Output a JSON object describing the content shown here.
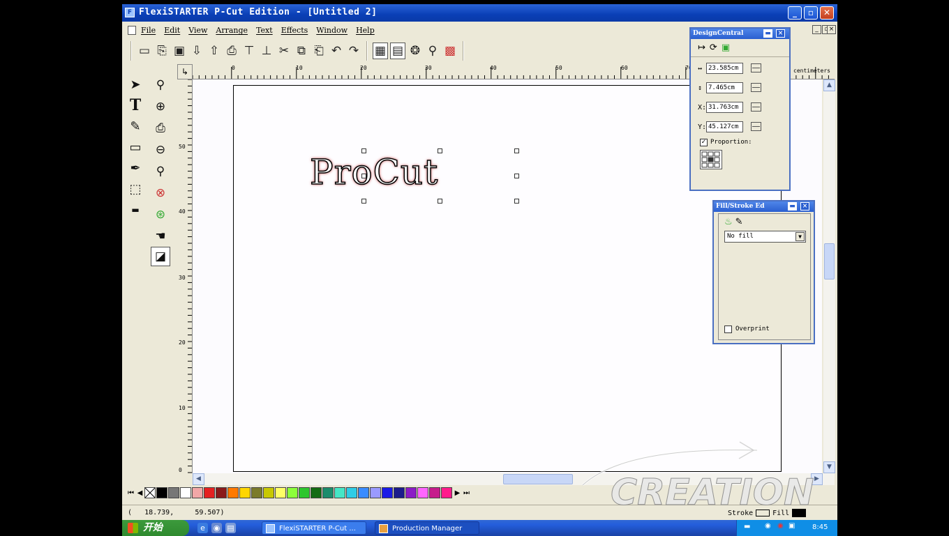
{
  "window": {
    "title": "FlexiSTARTER P-Cut Edition - [Untitled 2]",
    "min_glyph": "_",
    "max_glyph": "▫",
    "close_glyph": "✕"
  },
  "menu": {
    "items": [
      {
        "label": "File"
      },
      {
        "label": "Edit"
      },
      {
        "label": "View"
      },
      {
        "label": "Arrange"
      },
      {
        "label": "Text"
      },
      {
        "label": "Effects"
      },
      {
        "label": "Window"
      },
      {
        "label": "Help"
      }
    ]
  },
  "toolbar": {
    "buttons": [
      {
        "icon": "new-icon",
        "glyph": "▭"
      },
      {
        "icon": "open-icon",
        "glyph": "⎘"
      },
      {
        "icon": "save-icon",
        "glyph": "▣"
      },
      {
        "icon": "import-icon",
        "glyph": "⇩"
      },
      {
        "icon": "export-icon",
        "glyph": "⇧"
      },
      {
        "icon": "print-icon",
        "glyph": "⎙"
      },
      {
        "icon": "cut-to-plotter-icon",
        "glyph": "⊤"
      },
      {
        "icon": "production-icon",
        "glyph": "⊥"
      },
      {
        "icon": "scissors-icon",
        "glyph": "✂"
      },
      {
        "icon": "copy-icon",
        "glyph": "⧉"
      },
      {
        "icon": "paste-icon",
        "glyph": "⎗"
      },
      {
        "icon": "undo-icon",
        "glyph": "↶"
      },
      {
        "icon": "redo-icon",
        "glyph": "↷"
      },
      {
        "icon": "design-central-icon",
        "glyph": "▦"
      },
      {
        "icon": "fill-stroke-icon",
        "glyph": "▤"
      },
      {
        "icon": "color-icon",
        "glyph": "❂"
      },
      {
        "icon": "zoom-tool-icon",
        "glyph": "⚲"
      },
      {
        "icon": "swatch-icon",
        "glyph": "▩"
      }
    ]
  },
  "rulers": {
    "units": "centimeters",
    "h_labels": [
      "0",
      "10",
      "20",
      "30",
      "40",
      "50",
      "60",
      "70"
    ],
    "v_labels": [
      "50",
      "40",
      "30",
      "20",
      "10",
      "0"
    ]
  },
  "canvas": {
    "text": "ProCut"
  },
  "design_central": {
    "title": "DesignCentral",
    "width": "23.585cm",
    "height": "7.465cm",
    "x_label": "X:",
    "x": "31.763cm",
    "y_label": "Y:",
    "y": "45.127cm",
    "proportional_label": "Proportion:",
    "proportional_checked": "✓"
  },
  "fill_stroke": {
    "title": "Fill/Stroke Ed",
    "fill_value": "No fill",
    "overprint_label": "Overprint"
  },
  "palette": {
    "colors": [
      "#ffffff",
      "#f1a7a7",
      "#e52121",
      "#8a1a1a",
      "#ff7a00",
      "#ffd600",
      "#7b7b2a",
      "#c8c800",
      "#ffff66",
      "#8cff3a",
      "#2ec62e",
      "#136c13",
      "#1c8c6c",
      "#46e6c6",
      "#2ecce6",
      "#3a8cff",
      "#9a9aff",
      "#1c1ce6",
      "#1c1c8c",
      "#8c1cc6",
      "#ff66ff",
      "#c61c8c",
      "#ff1c8c"
    ]
  },
  "status": {
    "coords": "(   18.739,     59.507)",
    "stroke_label": "Stroke",
    "fill_label": "Fill"
  },
  "taskbar": {
    "start_label": "开始",
    "tasks": [
      {
        "label": "FlexiSTARTER P-Cut ..."
      },
      {
        "label": "Production Manager"
      }
    ],
    "clock": "8:45"
  },
  "watermark": {
    "text": "CREATION"
  },
  "colors": {
    "titlebar": "#0a3fb6",
    "selection_outline": "#c66666",
    "panel_border": "#4a6fc2"
  }
}
